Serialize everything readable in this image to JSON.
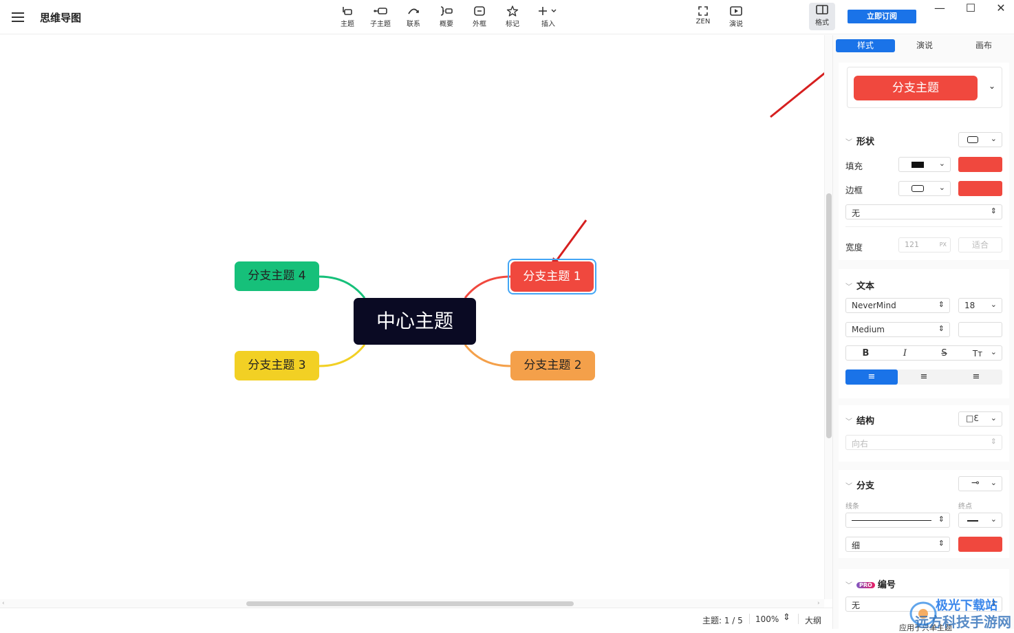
{
  "app": {
    "title": "思维导图"
  },
  "toolbar": {
    "topic": "主题",
    "subtopic": "子主题",
    "relationship": "联系",
    "summary": "概要",
    "boundary": "外框",
    "marker": "标记",
    "insert": "插入",
    "zen": "ZEN",
    "present": "演说",
    "format": "格式",
    "subscribe": "立即订阅"
  },
  "mindmap": {
    "central": "中心主题",
    "branches": [
      "分支主题 1",
      "分支主题 2",
      "分支主题 3",
      "分支主题 4"
    ],
    "colors": {
      "central": "#0a0a23",
      "b1": "#f0483e",
      "b2": "#f4a04a",
      "b3": "#f2d024",
      "b4": "#16c07a",
      "selection": "#42a5f5"
    }
  },
  "statusbar": {
    "topics": "主题: 1 / 5",
    "zoom": "100%",
    "outline": "大纲"
  },
  "panel": {
    "tabs": [
      "样式",
      "演说",
      "画布"
    ],
    "preview": "分支主题",
    "shape": {
      "title": "形状",
      "fill_label": "填充",
      "border_label": "边框",
      "border_style": "无",
      "width_label": "宽度",
      "width_value": "121",
      "width_unit": "PX",
      "fit": "适合"
    },
    "text": {
      "title": "文本",
      "font": "NeverMind",
      "size": "18",
      "weight": "Medium",
      "bold": "B",
      "italic": "I",
      "strike": "S",
      "case": "Tт"
    },
    "structure": {
      "title": "结构",
      "direction": "向右"
    },
    "branch": {
      "title": "分支",
      "line_label": "线条",
      "end_label": "终点",
      "thickness": "细"
    },
    "numbering": {
      "pro": "PRO",
      "title": "编号",
      "value": "无",
      "apply": "应用于只单主题"
    },
    "accent": "#f0483e"
  },
  "watermark": {
    "line1": "极光下载站",
    "line2": "远方科技手游网"
  }
}
